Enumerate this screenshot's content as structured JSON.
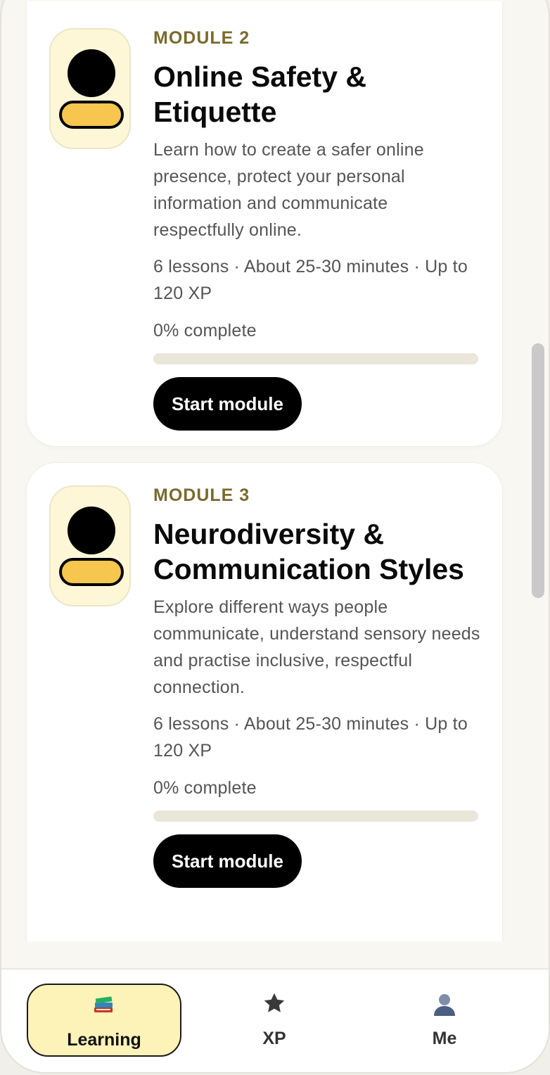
{
  "modules": [
    {
      "kicker": "MODULE 2",
      "title": "Online Safety & Etiquette",
      "description": "Learn how to create a safer online presence, protect your personal information and communicate respectfully online.",
      "meta": "6 lessons · About 25-30 minutes · Up to 120 XP",
      "progress_label": "0% complete",
      "progress": 0,
      "button_label": "Start module"
    },
    {
      "kicker": "MODULE 3",
      "title": "Neurodiversity & Communication Styles",
      "description": "Explore different ways people communicate, understand sensory needs and practise inclusive, respectful connection.",
      "meta": "6 lessons · About 25-30 minutes · Up to 120 XP",
      "progress_label": "0% complete",
      "progress": 0,
      "button_label": "Start module"
    }
  ],
  "nav": {
    "items": [
      {
        "label": "Learning",
        "icon": "books-icon",
        "active": true
      },
      {
        "label": "XP",
        "icon": "star-icon",
        "active": false
      },
      {
        "label": "Me",
        "icon": "user-icon",
        "active": false
      }
    ]
  },
  "colors": {
    "accent": "#f6c64f",
    "kicker": "#7a6a2c",
    "active_nav": "#fdf2b8"
  }
}
